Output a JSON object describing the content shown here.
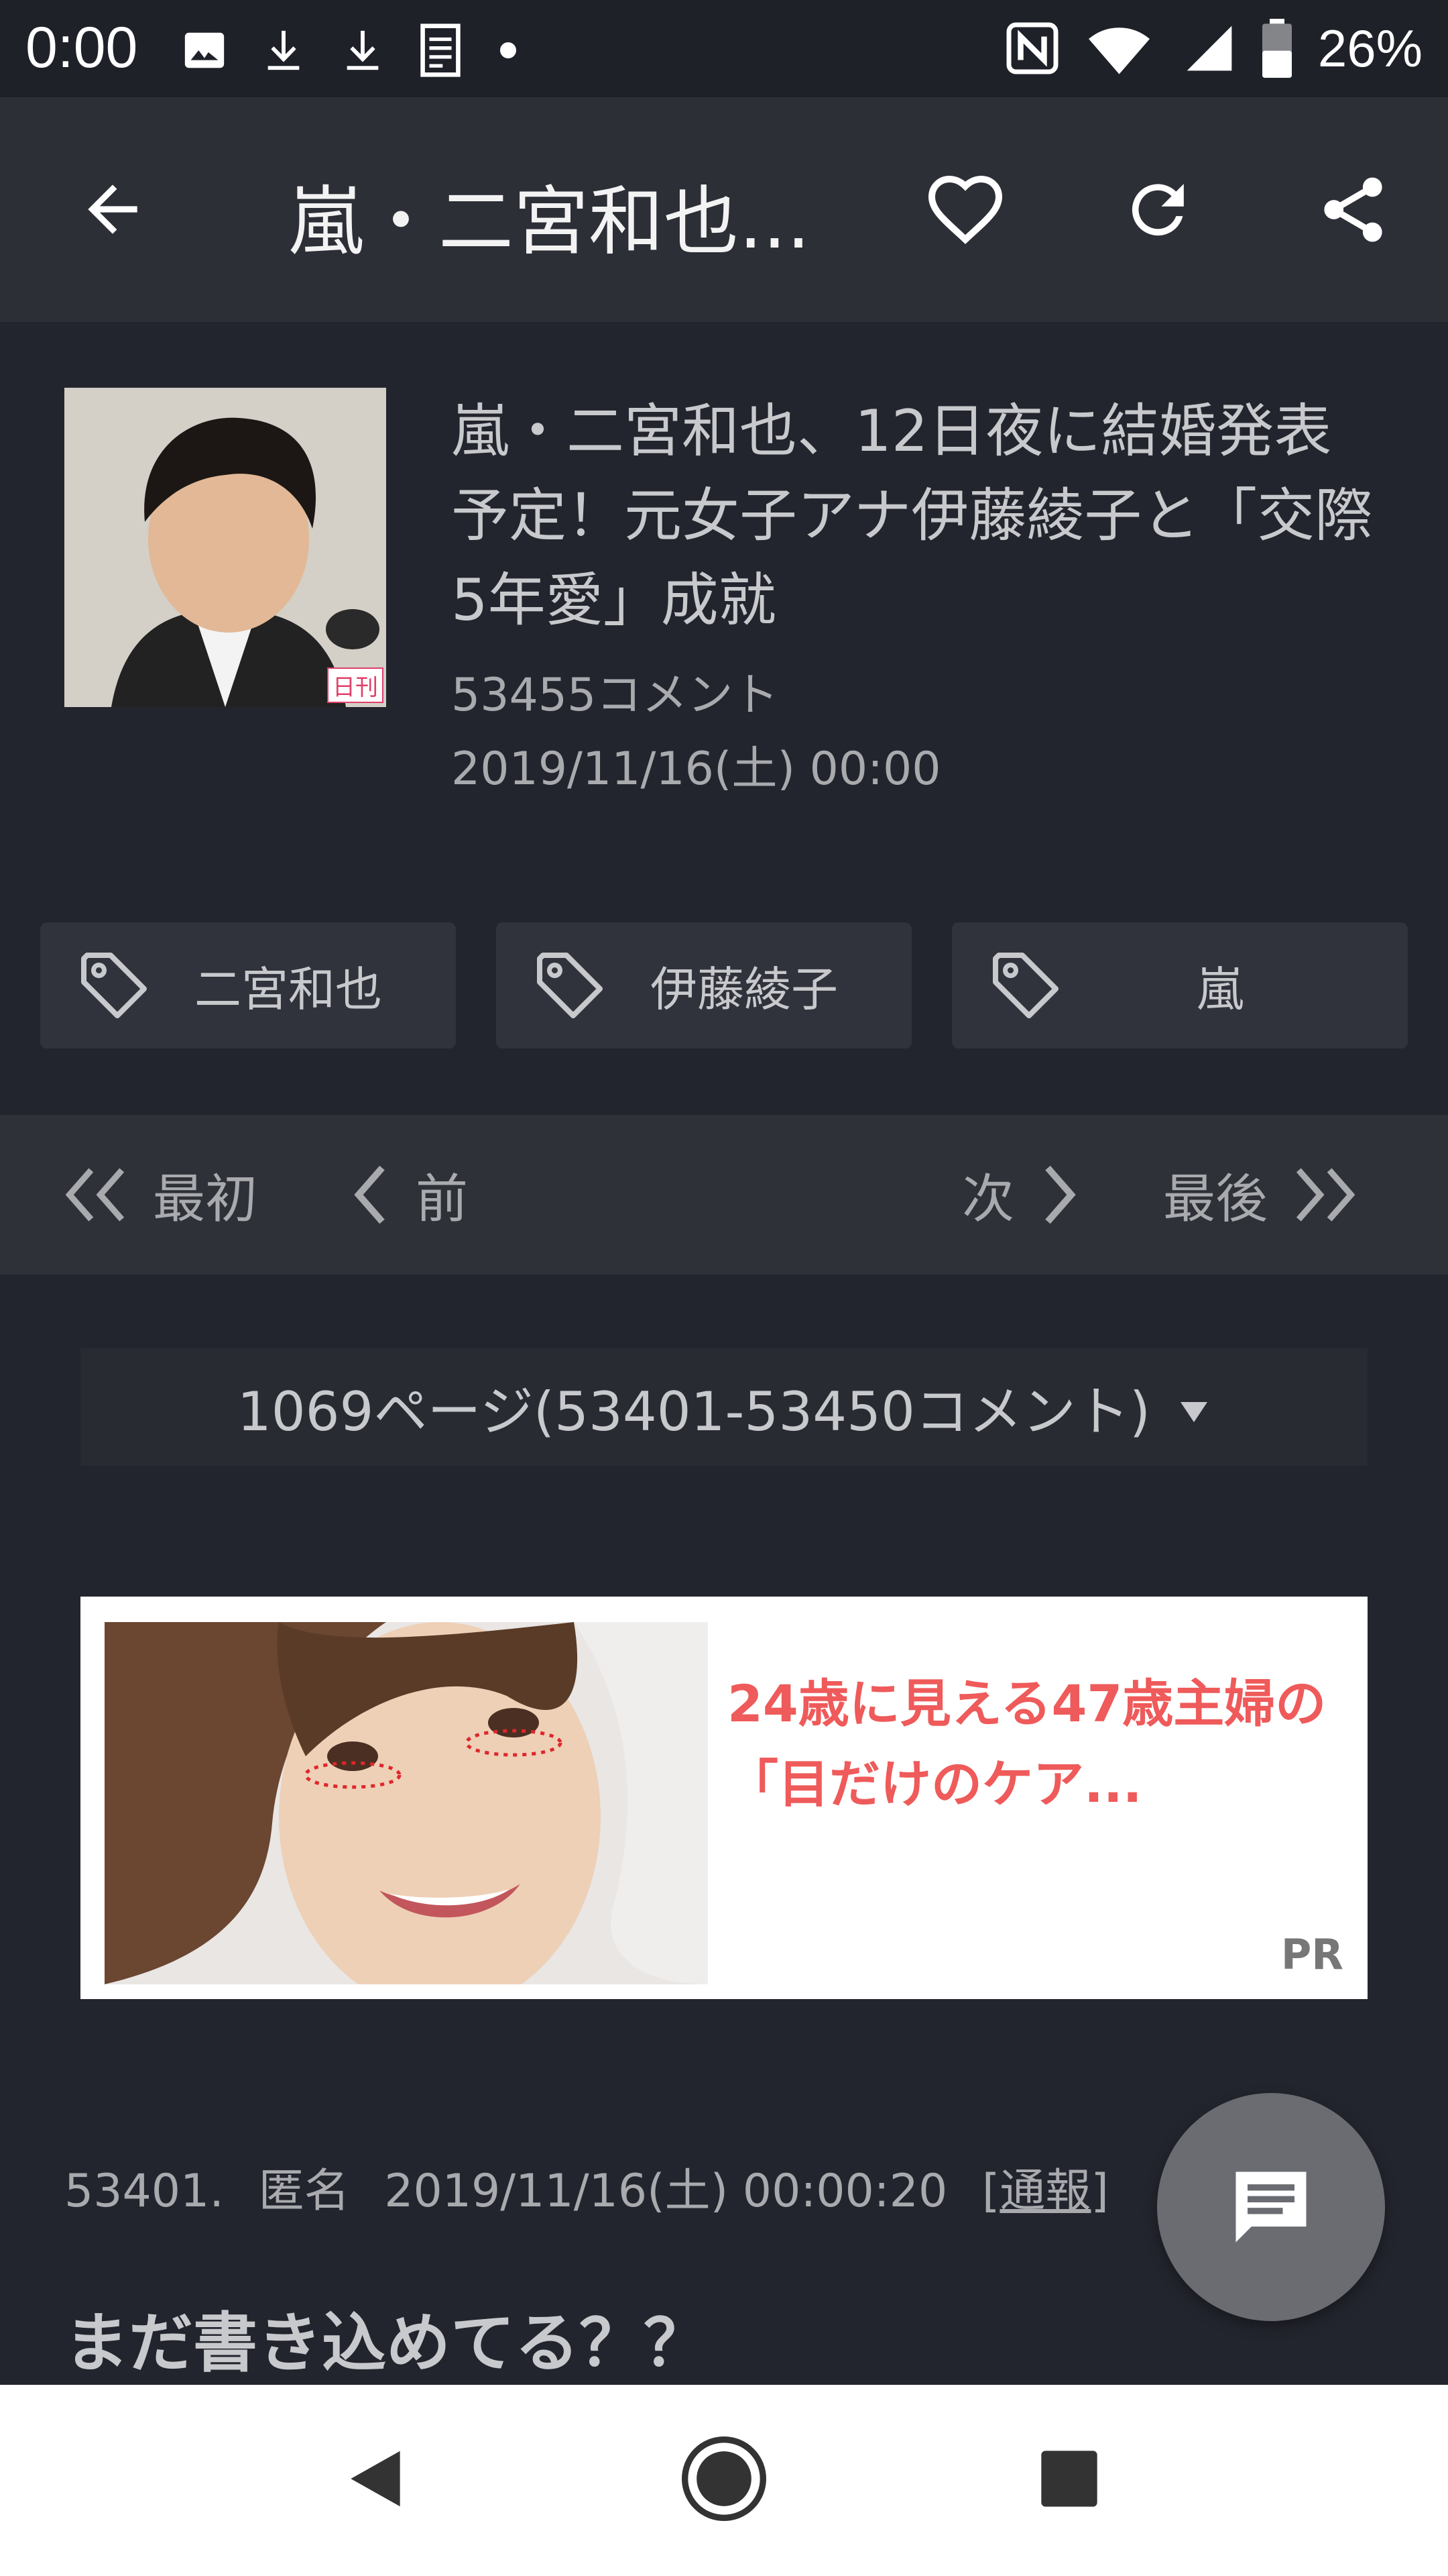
{
  "status_bar": {
    "time": "0:00",
    "battery": "26%",
    "left_icons": [
      "image-icon",
      "download-icon",
      "download-icon",
      "document-icon",
      "dot-icon"
    ],
    "right_icons": [
      "nfc-icon",
      "wifi-icon",
      "signal-icon",
      "battery-icon"
    ]
  },
  "app_bar": {
    "title": "嵐・二宮和也...",
    "actions": [
      "back-arrow-icon",
      "heart-icon",
      "refresh-icon",
      "share-icon"
    ]
  },
  "article": {
    "headline": "嵐・二宮和也、12日夜に結婚発表予定！元女子アナ伊藤綾子と「交際5年愛」成就",
    "comment_count": "53455コメント",
    "date": "2019/11/16(土) 00:00",
    "thumbnail_badge": "日刊"
  },
  "tags": [
    {
      "label": "二宮和也"
    },
    {
      "label": "伊藤綾子"
    },
    {
      "label": "嵐"
    }
  ],
  "pagination": {
    "first": "最初",
    "prev": "前",
    "next": "次",
    "last": "最後"
  },
  "page_select": {
    "value": "1069ページ(53401-53450コメント)"
  },
  "ad": {
    "text": "24歳に見える47歳主婦の「目だけのケア...",
    "badge": "PR"
  },
  "comment": {
    "number": "53401.",
    "author": "匿名",
    "timestamp": "2019/11/16(土) 00:00:20",
    "report_label": "通報",
    "body": "まだ書き込めてる？？"
  },
  "colors": {
    "background": "#23252e",
    "app_bar": "#2d2f37",
    "ad_text": "#ef5a5a",
    "fab": "#6a6c72"
  }
}
